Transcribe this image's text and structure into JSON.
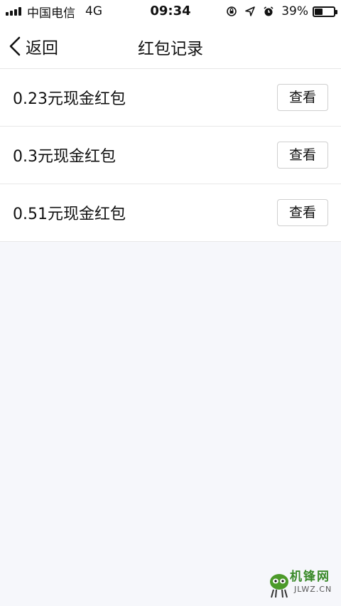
{
  "status_bar": {
    "carrier": "中国电信",
    "network": "4G",
    "time": "09:34",
    "battery_percent": "39%",
    "battery_level": 0.39,
    "icons": [
      "orientation-lock-icon",
      "location-arrow-icon",
      "alarm-clock-icon"
    ]
  },
  "nav": {
    "back_label": "返回",
    "title": "红包记录"
  },
  "records": [
    {
      "label": "0.23元现金红包",
      "button": "查看"
    },
    {
      "label": "0.3元现金红包",
      "button": "查看"
    },
    {
      "label": "0.51元现金红包",
      "button": "查看"
    }
  ],
  "watermark": {
    "text": "机锋网",
    "site": "JLWZ.CN"
  },
  "colors": {
    "background": "#f6f7fb",
    "surface": "#ffffff",
    "text": "#111111",
    "divider": "#e8e8e8",
    "watermark": "#3a8a2a"
  }
}
